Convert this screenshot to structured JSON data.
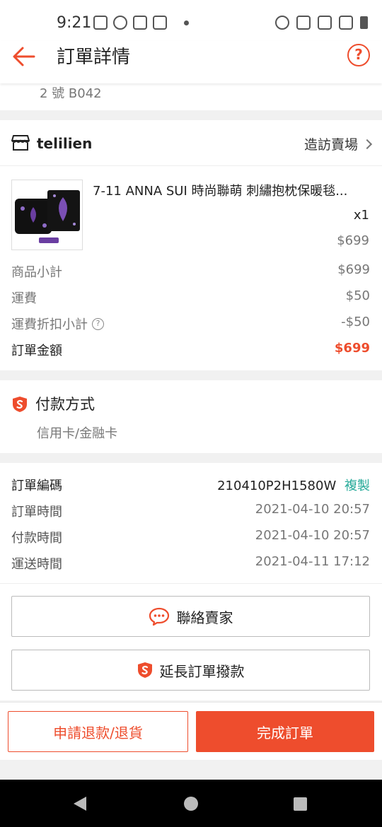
{
  "status_bar": {
    "time": "9:21",
    "left_icons": [
      "notes-icon",
      "line-icon",
      "shopee-icon",
      "shopee-icon"
    ],
    "right_icons": [
      "alarm-icon",
      "vibrate-icon",
      "network-icon",
      "signal-icon",
      "battery-icon"
    ]
  },
  "header": {
    "title": "訂單詳情",
    "help_symbol": "?"
  },
  "address": {
    "line": "2 號 B042"
  },
  "shop": {
    "name": "telilien",
    "visit_label": "造訪賣場"
  },
  "product": {
    "name": "7-11 ANNA SUI 時尚聯萌 刺繡抱枕保暖毯...",
    "quantity": "x1",
    "price": "$699"
  },
  "summary": {
    "subtotal_label": "商品小計",
    "subtotal_value": "$699",
    "shipping_label": "運費",
    "shipping_value": "$50",
    "shipping_discount_label": "運費折扣小計",
    "shipping_discount_value": "-$50",
    "total_label": "訂單金額",
    "total_value": "$699"
  },
  "payment": {
    "title": "付款方式",
    "method": "信用卡/金融卡"
  },
  "order_info": {
    "order_no_label": "訂單編碼",
    "order_no_value": "210410P2H1580W",
    "copy_label": "複製",
    "order_time_label": "訂單時間",
    "order_time_value": "2021-04-10 20:57",
    "payment_time_label": "付款時間",
    "payment_time_value": "2021-04-10 20:57",
    "shipping_time_label": "運送時間",
    "shipping_time_value": "2021-04-11 17:12"
  },
  "actions": {
    "contact_seller": "聯絡賣家",
    "extend_payment": "延長訂單撥款",
    "refund_return": "申請退款/退貨",
    "complete_order": "完成訂單"
  },
  "colors": {
    "accent": "#ee4d2d",
    "copy_link": "#26aa99",
    "purple_print": "#6a3ea1"
  }
}
